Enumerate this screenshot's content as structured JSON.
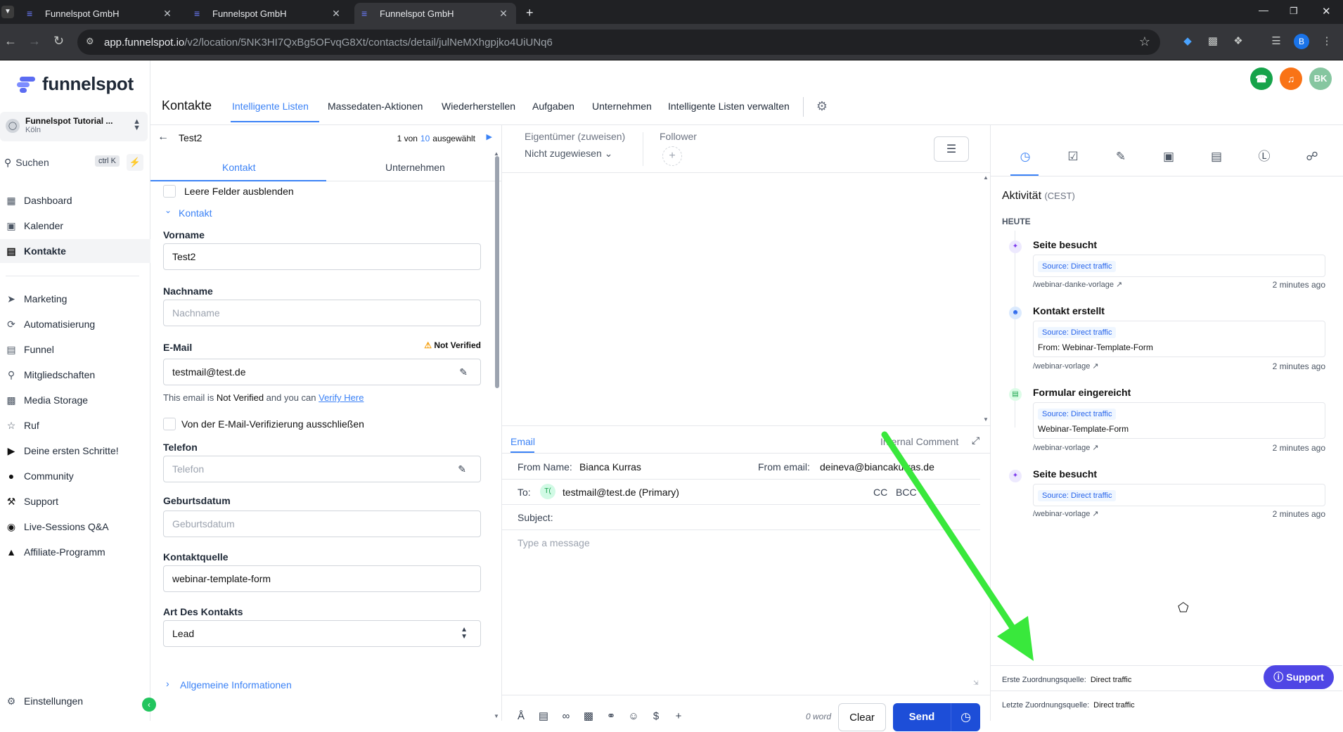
{
  "browser": {
    "tabs": [
      {
        "title": "Funnelspot GmbH",
        "active": false
      },
      {
        "title": "Funnelspot GmbH",
        "active": false
      },
      {
        "title": "Funnelspot GmbH",
        "active": true
      }
    ],
    "url_host": "app.funnelspot.io",
    "url_path": "/v2/location/5NK3HI7QxBg5OFvqG8Xt/contacts/detail/julNeMXhgpjko4UiUNq6",
    "profile_initial": "B"
  },
  "brand": {
    "name": "funnelspot",
    "accent": "#5b6cf2"
  },
  "account": {
    "name": "Funnelspot Tutorial ...",
    "city": "Köln"
  },
  "search": {
    "label": "Suchen",
    "shortcut": "ctrl K"
  },
  "sidebar": {
    "items": [
      {
        "label": "Dashboard",
        "icon": "grid-icon",
        "active": false
      },
      {
        "label": "Kalender",
        "icon": "calendar-icon",
        "active": false
      },
      {
        "label": "Kontakte",
        "icon": "contacts-icon",
        "active": true
      },
      {
        "label": "Marketing",
        "icon": "send-icon",
        "active": false
      },
      {
        "label": "Automatisierung",
        "icon": "automation-icon",
        "active": false
      },
      {
        "label": "Funnel",
        "icon": "funnel-icon",
        "active": false
      },
      {
        "label": "Mitgliedschaften",
        "icon": "badge-icon",
        "active": false
      },
      {
        "label": "Media Storage",
        "icon": "image-icon",
        "active": false
      },
      {
        "label": "Ruf",
        "icon": "star-icon",
        "active": false
      },
      {
        "label": "Deine ersten Schritte!",
        "icon": "play-icon",
        "active": false
      },
      {
        "label": "Community",
        "icon": "people-icon",
        "active": false
      },
      {
        "label": "Support",
        "icon": "wrench-icon",
        "active": false
      },
      {
        "label": "Live-Sessions Q&A",
        "icon": "chat-icon",
        "active": false
      },
      {
        "label": "Affiliate-Programm",
        "icon": "affiliate-icon",
        "active": false
      }
    ],
    "settings": "Einstellungen"
  },
  "header": {
    "title": "Kontakte",
    "tabs": [
      "Intelligente Listen",
      "Massedaten-Aktionen",
      "Wiederherstellen",
      "Aufgaben",
      "Unternehmen",
      "Intelligente Listen verwalten"
    ],
    "active_tab": "Intelligente Listen",
    "user_initials": "BK"
  },
  "contact": {
    "name": "Test2",
    "pager_prefix": "1 von",
    "pager_count": "10",
    "pager_suffix": "ausgewählt",
    "tabs": [
      "Kontakt",
      "Unternehmen"
    ],
    "hide_empty": "Leere Felder ausblenden",
    "section": "Kontakt",
    "fields": {
      "vorname_label": "Vorname",
      "vorname_value": "Test2",
      "nachname_label": "Nachname",
      "nachname_placeholder": "Nachname",
      "email_label": "E-Mail",
      "email_status": "Not Verified",
      "email_value": "testmail@test.de",
      "email_note_1": "This email is ",
      "email_note_2": "Not Verified",
      "email_note_3": " and you can ",
      "email_note_link": "Verify Here",
      "exclude_verify": "Von der E-Mail-Verifizierung ausschließen",
      "telefon_label": "Telefon",
      "telefon_placeholder": "Telefon",
      "geburt_label": "Geburtsdatum",
      "geburt_placeholder": "Geburtsdatum",
      "quelle_label": "Kontaktquelle",
      "quelle_value": "webinar-template-form",
      "art_label": "Art Des Kontakts",
      "art_value": "Lead",
      "more_section": "Allgemeine Informationen"
    }
  },
  "owner": {
    "label": "Eigentümer (zuweisen)",
    "value": "Nicht zugewiesen",
    "follower_label": "Follower"
  },
  "composer": {
    "tab_email": "Email",
    "tab_internal": "Internal Comment",
    "from_name_label": "From Name:",
    "from_name": "Bianca Kurras",
    "from_email_label": "From email:",
    "from_email": "deineva@biancakurras.de",
    "to_label": "To:",
    "to_initials": "T(",
    "to_value": "testmail@test.de (Primary)",
    "cc": "CC",
    "bcc": "BCC",
    "subject_label": "Subject:",
    "message_placeholder": "Type a message",
    "word_count": "0 word",
    "clear": "Clear",
    "send": "Send"
  },
  "activity": {
    "title": "Aktivität",
    "tz": "(CEST)",
    "day": "HEUTE",
    "items": [
      {
        "title": "Seite besucht",
        "badge": "Source: Direct traffic",
        "extra": "",
        "link": "/webinar-danke-vorlage",
        "time": "2 minutes ago",
        "color": "#ede9fe"
      },
      {
        "title": "Kontakt erstellt",
        "badge": "Source: Direct traffic",
        "extra": "From: Webinar-Template-Form",
        "link": "/webinar-vorlage",
        "time": "2 minutes ago",
        "color": "#dbeafe"
      },
      {
        "title": "Formular eingereicht",
        "badge": "Source: Direct traffic",
        "extra": "Webinar-Template-Form",
        "link": "/webinar-vorlage",
        "time": "2 minutes ago",
        "color": "#dcfce7"
      },
      {
        "title": "Seite besucht",
        "badge": "Source: Direct traffic",
        "extra": "",
        "link": "/webinar-vorlage",
        "time": "2 minutes ago",
        "color": "#ede9fe"
      }
    ],
    "first_source_label": "Erste Zuordnungsquelle:",
    "first_source": "Direct traffic",
    "last_source_label": "Letzte Zuordnungsquelle:",
    "last_source": "Direct traffic",
    "support_label": "Support"
  }
}
